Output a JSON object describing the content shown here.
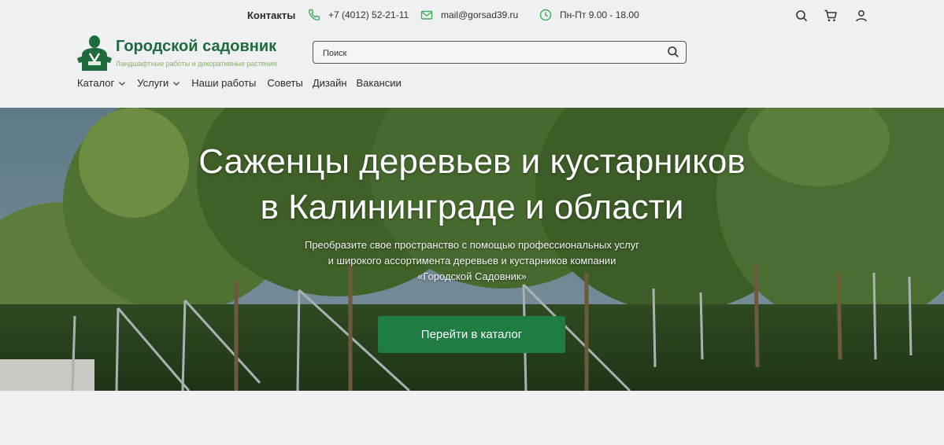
{
  "header": {
    "contacts_label": "Контакты",
    "phone": "+7 (4012) 52-21-11",
    "email": "mail@gorsad39.ru",
    "hours": "Пн-Пт 9.00 - 18.00",
    "icons": [
      "search-icon",
      "cart-icon",
      "user-icon"
    ]
  },
  "logo": {
    "name": "Городской садовник",
    "tagline": "Ландшафтные работы и декоративные растения"
  },
  "search": {
    "placeholder": "Поиск"
  },
  "nav": {
    "items": [
      {
        "label": "Каталог",
        "dropdown": true
      },
      {
        "label": "Услуги",
        "dropdown": true
      },
      {
        "label": "Наши работы",
        "dropdown": false
      },
      {
        "label": "Советы",
        "dropdown": false
      },
      {
        "label": "Дизайн",
        "dropdown": false
      },
      {
        "label": "Вакансии",
        "dropdown": false
      }
    ]
  },
  "hero": {
    "title_line1": "Саженцы деревьев и кустарников",
    "title_line2": "в Калининграде и области",
    "subtitle_line1": "Преобразите свое пространство с помощью профессиональных услуг",
    "subtitle_line2": "и широкого ассортимента деревьев и кустарников компании",
    "subtitle_line3": "«Городской Садовник»",
    "cta_label": "Перейти в каталог"
  },
  "colors": {
    "brand_green": "#1f6b3d",
    "accent_green": "#3fae5a",
    "cta_green": "#1f7d44",
    "tagline_green": "#8cb16a"
  }
}
